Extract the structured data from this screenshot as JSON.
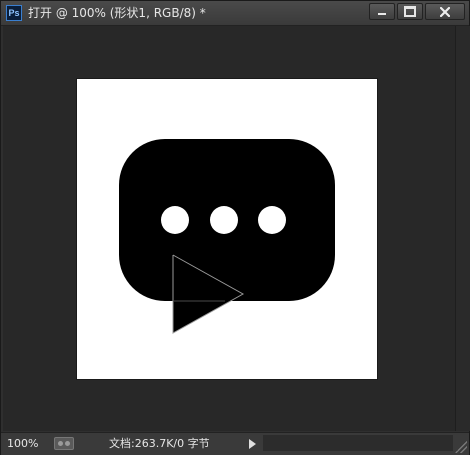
{
  "window": {
    "app_icon": "ps-app-icon",
    "app_icon_text": "Ps",
    "title": "打开 @ 100% (形状1, RGB/8) *",
    "controls": {
      "minimize": "minimize-icon",
      "maximize": "maximize-icon",
      "close": "close-icon"
    }
  },
  "canvas": {
    "background": "#ffffff",
    "artwork": "chat-bubble-icon",
    "colors": {
      "shape": "#000000",
      "dots": "#ffffff",
      "triangle_outline": "#9a9a9a"
    }
  },
  "statusbar": {
    "zoom": "100%",
    "doc_info": "文档:263.7K/0 字节",
    "menu_arrow": "triangle-right-icon"
  }
}
